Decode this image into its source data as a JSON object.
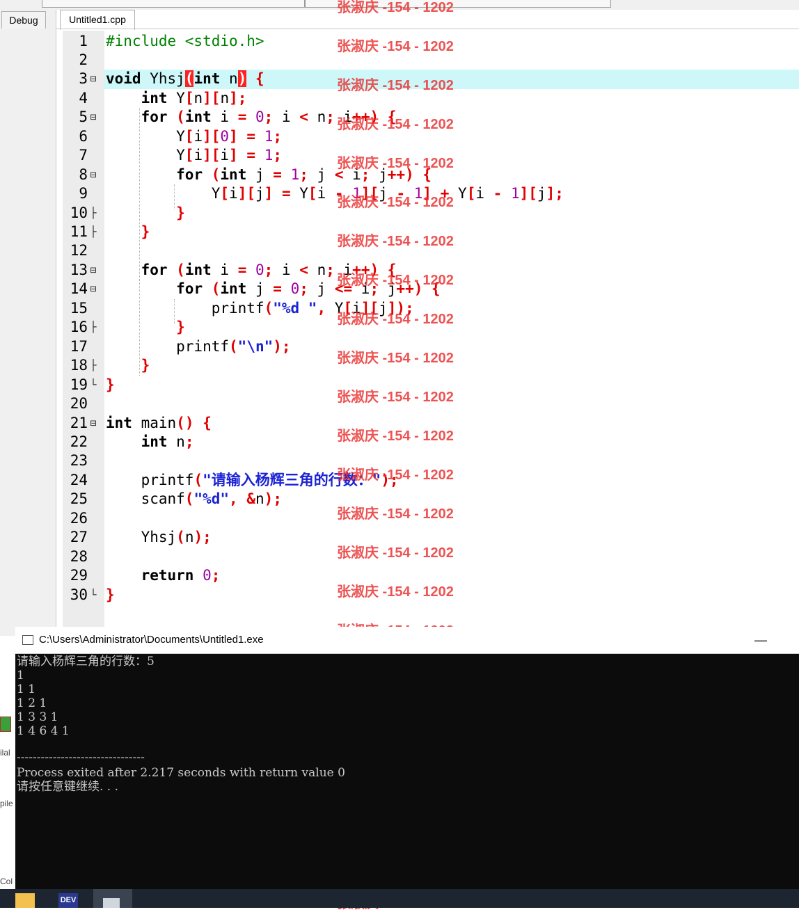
{
  "ide": {
    "debug_tab": "Debug",
    "file_tab": "Untitled1.cpp"
  },
  "code_lines": [
    "#include <stdio.h>",
    "",
    "void Yhsj(int n) {",
    "    int Y[n][n];",
    "    for (int i = 0; i < n; i++) {",
    "        Y[i][0] = 1;",
    "        Y[i][i] = 1;",
    "        for (int j = 1; j < i; j++) {",
    "            Y[i][j] = Y[i - 1][j - 1] + Y[i - 1][j];",
    "        }",
    "    }",
    "",
    "    for (int i = 0; i < n; i++) {",
    "        for (int j = 0; j <= i; j++) {",
    "            printf(\"%d \", Y[i][j]);",
    "        }",
    "        printf(\"\\n\");",
    "    }",
    "}",
    "",
    "int main() {",
    "    int n;",
    "",
    "    printf(\"请输入杨辉三角的行数：\");",
    "    scanf(\"%d\", &n);",
    "",
    "    Yhsj(n);",
    "",
    "    return 0;",
    "}"
  ],
  "highlighted_line": 3,
  "console": {
    "title": "C:\\Users\\Administrator\\Documents\\Untitled1.exe",
    "minimize": "—",
    "lines": [
      "请输入杨辉三角的行数：5",
      "1",
      "1 1",
      "1 2 1",
      "1 3 3 1",
      "1 4 6 4 1",
      "",
      "--------------------------------",
      "Process exited after 2.217 seconds with return value 0",
      "请按任意键继续. . ."
    ]
  },
  "watermark": "张淑庆 -154 - 1202",
  "left_fragments": [
    "ilal",
    "pile",
    "Col"
  ],
  "taskbar": {
    "icons": [
      "folder-icon",
      "devcpp-icon",
      "console-window-icon"
    ],
    "dev_label": "DEV"
  }
}
